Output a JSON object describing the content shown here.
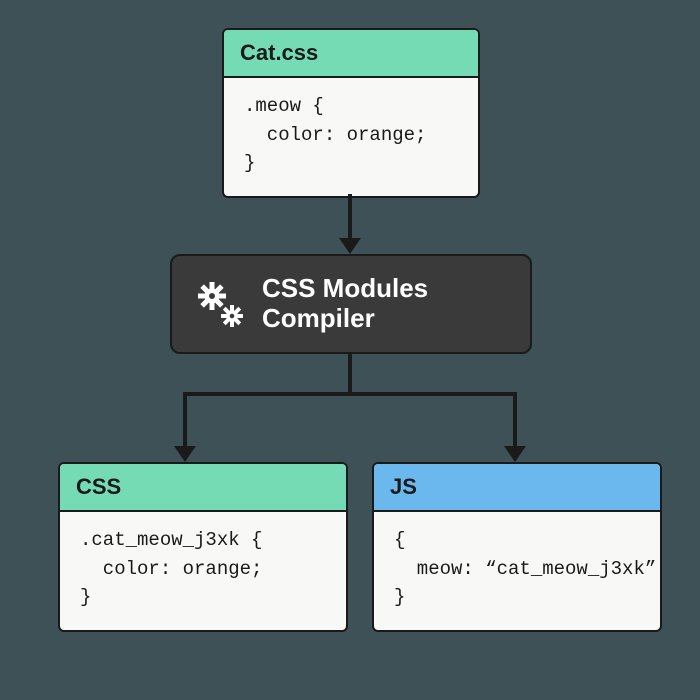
{
  "source": {
    "title": "Cat.css",
    "code": ".meow {\n  color: orange;\n}"
  },
  "compiler": {
    "label_line1": "CSS Modules",
    "label_line2": "Compiler"
  },
  "output_css": {
    "title": "CSS",
    "code": ".cat_meow_j3xk {\n  color: orange;\n}"
  },
  "output_js": {
    "title": "JS",
    "code": "{\n  meow: “cat_meow_j3xk”\n}"
  },
  "colors": {
    "green": "#74dbb5",
    "blue": "#6bb8ef",
    "dark": "#3a3a3a"
  }
}
